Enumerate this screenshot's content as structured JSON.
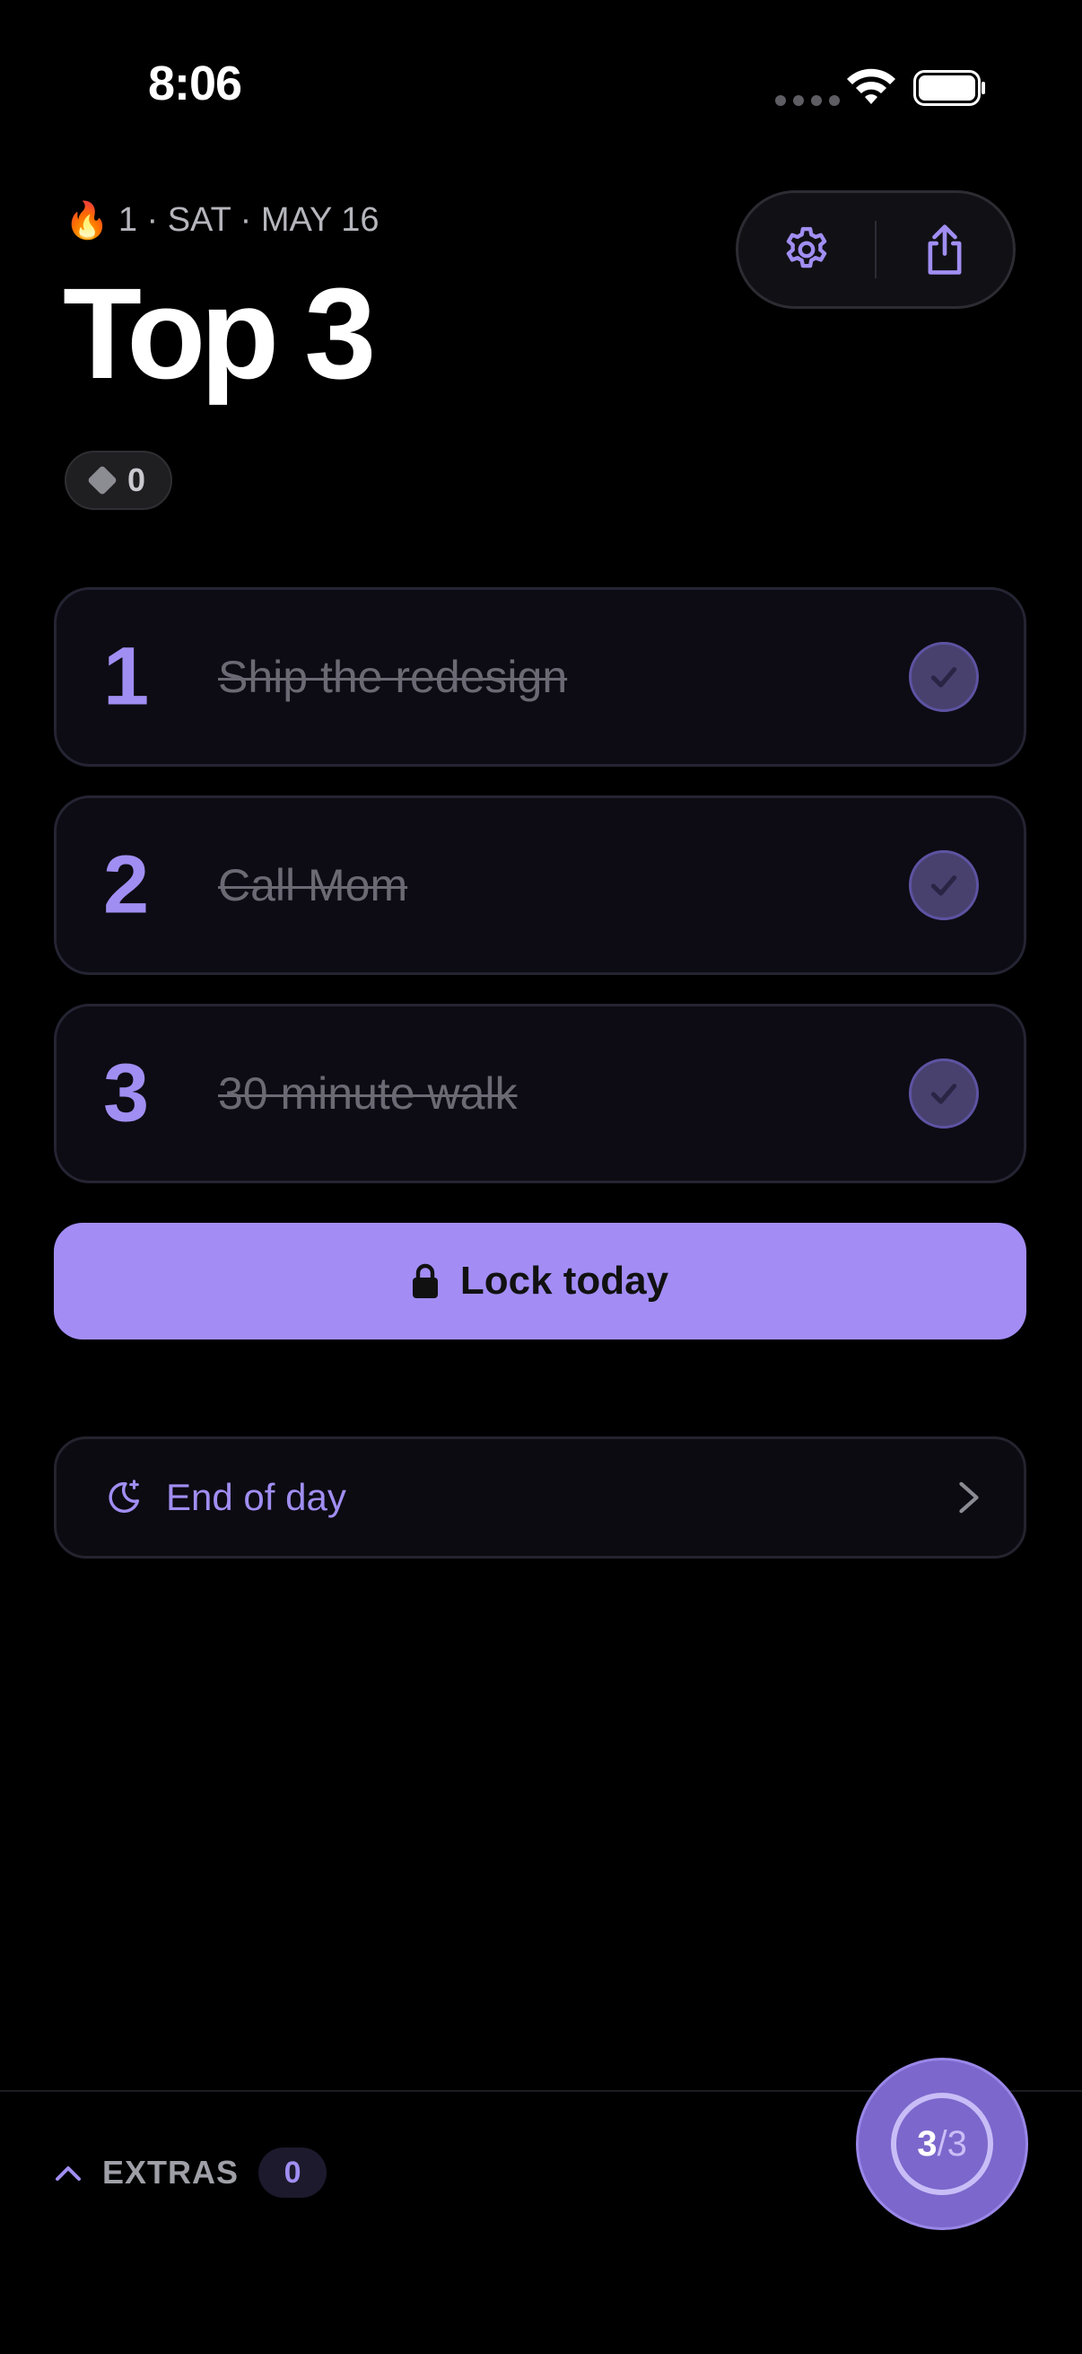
{
  "status_bar": {
    "time": "8:06"
  },
  "header": {
    "streak_emoji": "🔥",
    "meta": "1 · SAT · MAY 16",
    "title": "Top 3",
    "gems": "0"
  },
  "toolbar": {
    "settings_icon": "gear-icon",
    "share_icon": "share-icon"
  },
  "tasks": [
    {
      "number": "1",
      "label": "Ship the redesign",
      "done": true
    },
    {
      "number": "2",
      "label": "Call Mom",
      "done": true
    },
    {
      "number": "3",
      "label": "30 minute walk",
      "done": true
    }
  ],
  "lock_button": {
    "label": "Lock today"
  },
  "end_of_day": {
    "label": "End of day"
  },
  "extras": {
    "label": "EXTRAS",
    "count": "0"
  },
  "progress": {
    "done": "3",
    "separator": "/",
    "total": "3"
  },
  "colors": {
    "accent": "#a38df5",
    "background": "#000000",
    "card": "#0d0c14"
  }
}
